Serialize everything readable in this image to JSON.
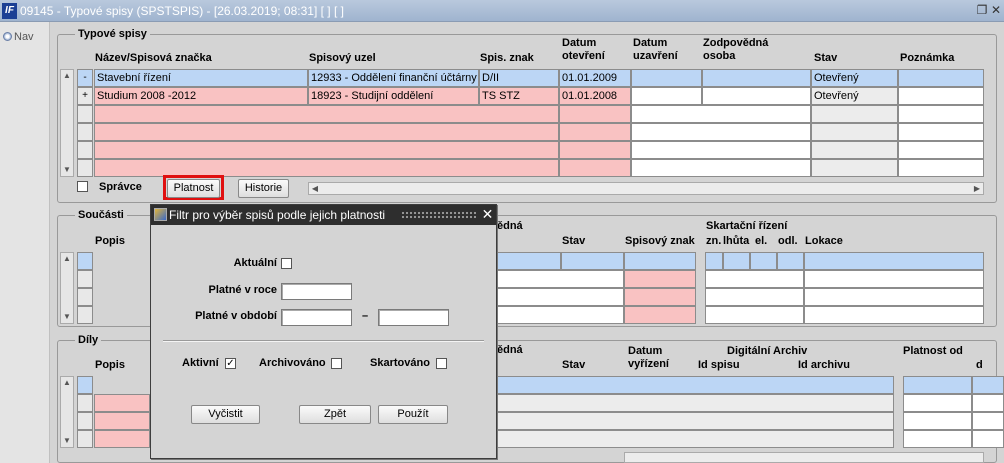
{
  "window": {
    "title": "09145 - Typové spisy (SPSTSPIS) - [26.03.2019; 08:31]  [ ]  [ ]",
    "logo": "IF",
    "nav_label": "Nav"
  },
  "typove_spisy": {
    "label": "Typové spisy",
    "headers": {
      "nazev": "Název/Spisová značka",
      "uzel": "Spisový uzel",
      "znak": "Spis. znak",
      "datum_otevreni": "Datum otevření",
      "datum_uzavreni": "Datum uzavření",
      "zodpovedna_osoba": "Zodpovědná osoba",
      "stav": "Stav",
      "poznamka": "Poznámka"
    },
    "rows": [
      {
        "toggle": "-",
        "nazev": "Stavební řízení",
        "uzel": "12933 - Oddělení finanční účtárny",
        "znak": "D/II",
        "datum_otevreni": "01.01.2009",
        "datum_uzavreni": "",
        "osoba": "",
        "stav": "Otevřený",
        "poznamka": ""
      },
      {
        "toggle": "+",
        "nazev": "Studium 2008 -2012",
        "uzel": "18923 - Studijní oddělení",
        "znak": "TS STZ",
        "datum_otevreni": "01.01.2008",
        "datum_uzavreni": "",
        "osoba": "",
        "stav": "Otevřený",
        "poznamka": ""
      }
    ],
    "spravce_label": "Správce",
    "platnost_button": "Platnost",
    "historie_button": "Historie"
  },
  "soucasti": {
    "label": "Součásti",
    "headers": {
      "popis": "Popis",
      "vedna": "ědná",
      "stav": "Stav",
      "spisovy_znak": "Spisový znak",
      "skartacni_rizeni": "Skartační řízení",
      "zn": "zn.",
      "lhuta": "lhůta",
      "el": "el.",
      "odl": "odl.",
      "lokace": "Lokace"
    }
  },
  "dily": {
    "label": "Díly",
    "headers": {
      "popis": "Popis",
      "vedna": "ědná",
      "stav": "Stav",
      "datum_vyrizeni": "Datum vyřízení",
      "digitalni_archiv": "Digitální Archiv",
      "id_spisu": "Id spisu",
      "id_archivu": "Id archivu",
      "platnost_od": "Platnost od",
      "d": "d"
    }
  },
  "dialog": {
    "title": "Filtr pro výběr spisů podle jejich platnosti",
    "aktualni_label": "Aktuální",
    "platne_v_roce_label": "Platné v roce",
    "platne_v_roce_value": "",
    "platne_v_obdobi_label": "Platné v období",
    "obdobi_od_value": "",
    "obdobi_do_value": "",
    "dash": "–",
    "aktivni_label": "Aktivní",
    "aktivni_checked": "✓",
    "archivovano_label": "Archivováno",
    "skartovano_label": "Skartováno",
    "vycistit_button": "Vyčistit",
    "zpet_button": "Zpět",
    "pouzit_button": "Použít"
  },
  "colors": {
    "pink_required": "#f9c2c2",
    "blue_selected": "#bcd6f5",
    "highlight_red": "#e01010"
  },
  "icons": [
    "logo-icon",
    "restore-icon",
    "close-icon",
    "nav-icon",
    "dialog-app-icon",
    "dialog-close-icon",
    "scroll-up-icon",
    "scroll-down-icon",
    "scroll-left-icon",
    "scroll-right-icon"
  ]
}
